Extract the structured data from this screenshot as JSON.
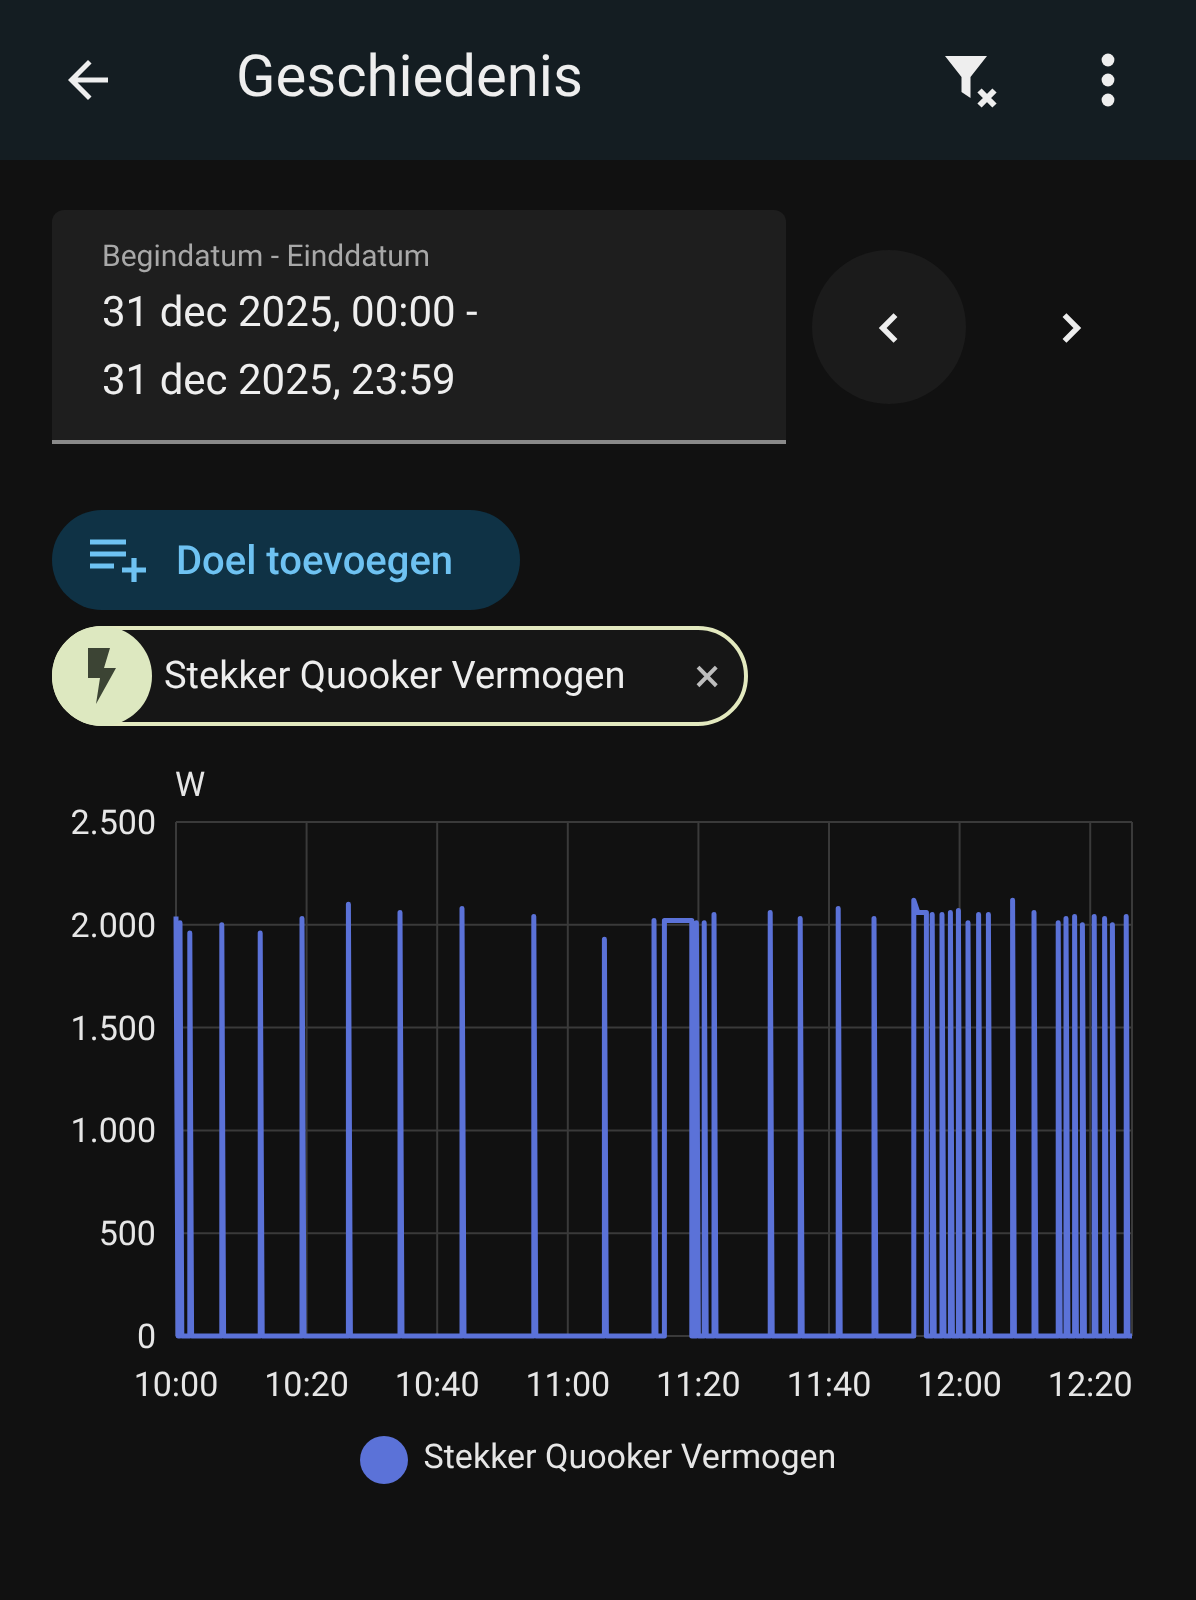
{
  "header": {
    "title": "Geschiedenis"
  },
  "date_range": {
    "label": "Begindatum - Einddatum",
    "value_lines": [
      "31 dec 2025, 00:00 -",
      "31 dec 2025, 23:59"
    ]
  },
  "add_target_button": {
    "label": "Doel toevoegen"
  },
  "target_chips": [
    {
      "label": "Stekker Quooker Vermogen",
      "remove": "×"
    }
  ],
  "chart": {
    "chart_data": {
      "type": "line",
      "ylabel": "W",
      "grid": true,
      "x": [
        600,
        600.3,
        600.6,
        600.6,
        600.9,
        602.1,
        602.1,
        602.4,
        607.0,
        607.0,
        607.3,
        612.9,
        612.9,
        613.2,
        619.3,
        619.3,
        619.6,
        626.4,
        626.4,
        626.7,
        634.3,
        634.3,
        634.6,
        643.8,
        643.8,
        644.1,
        654.8,
        654.8,
        655.1,
        665.6,
        665.6,
        665.9,
        673.2,
        673.2,
        673.5,
        674.8,
        674.8,
        679.0,
        679.0,
        679.7,
        679.7,
        680.0,
        680.9,
        680.9,
        681.2,
        682.4,
        682.4,
        682.7,
        691.0,
        691.0,
        691.3,
        695.6,
        695.6,
        695.9,
        701.4,
        701.4,
        701.7,
        706.9,
        706.9,
        707.2,
        713.0,
        713.0,
        713.6,
        714.9,
        714.9,
        715.8,
        715.8,
        716.1,
        717.3,
        717.3,
        717.6,
        718.6,
        718.6,
        718.9,
        719.8,
        719.8,
        720.1,
        721.3,
        721.3,
        721.6,
        722.9,
        722.9,
        723.2,
        724.4,
        724.4,
        724.7,
        728.1,
        728.1,
        728.4,
        731.4,
        731.4,
        731.7,
        735.1,
        735.1,
        735.4,
        736.3,
        736.3,
        736.6,
        737.6,
        737.6,
        737.9,
        738.8,
        738.8,
        739.1,
        740.6,
        740.6,
        740.9,
        742.2,
        742.2,
        742.5,
        743.4,
        743.4,
        743.7,
        745.5,
        745.5,
        745.8,
        746.4
      ],
      "series": [
        {
          "name": "Stekker Quooker Vermogen",
          "color": "#5b72d8",
          "values": [
            2040,
            0,
            0,
            2010,
            0,
            0,
            1960,
            0,
            0,
            2000,
            0,
            0,
            1960,
            0,
            0,
            2030,
            0,
            0,
            2100,
            0,
            0,
            2060,
            0,
            0,
            2080,
            0,
            0,
            2040,
            0,
            0,
            1930,
            0,
            0,
            2020,
            0,
            0,
            2020,
            2020,
            0,
            0,
            2010,
            0,
            0,
            2010,
            0,
            0,
            2050,
            0,
            0,
            2060,
            0,
            0,
            2030,
            0,
            0,
            2080,
            0,
            0,
            2030,
            0,
            0,
            2120,
            2060,
            2060,
            0,
            0,
            2050,
            0,
            0,
            2050,
            0,
            0,
            2060,
            0,
            0,
            2070,
            0,
            0,
            2010,
            0,
            0,
            2050,
            0,
            0,
            2050,
            0,
            0,
            2120,
            0,
            0,
            2060,
            0,
            0,
            2010,
            0,
            0,
            2030,
            0,
            0,
            2040,
            0,
            0,
            2000,
            0,
            0,
            2040,
            0,
            0,
            2030,
            0,
            0,
            2000,
            0,
            0,
            2040,
            0,
            0
          ]
        }
      ],
      "xlim": [
        600,
        746.4
      ],
      "ylim": [
        0,
        2500
      ],
      "xticks": [
        {
          "value": 600,
          "label": "10:00"
        },
        {
          "value": 620,
          "label": "10:20"
        },
        {
          "value": 640,
          "label": "10:40"
        },
        {
          "value": 660,
          "label": "11:00"
        },
        {
          "value": 680,
          "label": "11:20"
        },
        {
          "value": 700,
          "label": "11:40"
        },
        {
          "value": 720,
          "label": "12:00"
        },
        {
          "value": 740,
          "label": "12:20"
        }
      ],
      "yticks": [
        {
          "value": 0,
          "label": "0"
        },
        {
          "value": 500,
          "label": "500"
        },
        {
          "value": 1000,
          "label": "1.000"
        },
        {
          "value": 1500,
          "label": "1.500"
        },
        {
          "value": 2000,
          "label": "2.000"
        },
        {
          "value": 2500,
          "label": "2.500"
        }
      ]
    }
  }
}
